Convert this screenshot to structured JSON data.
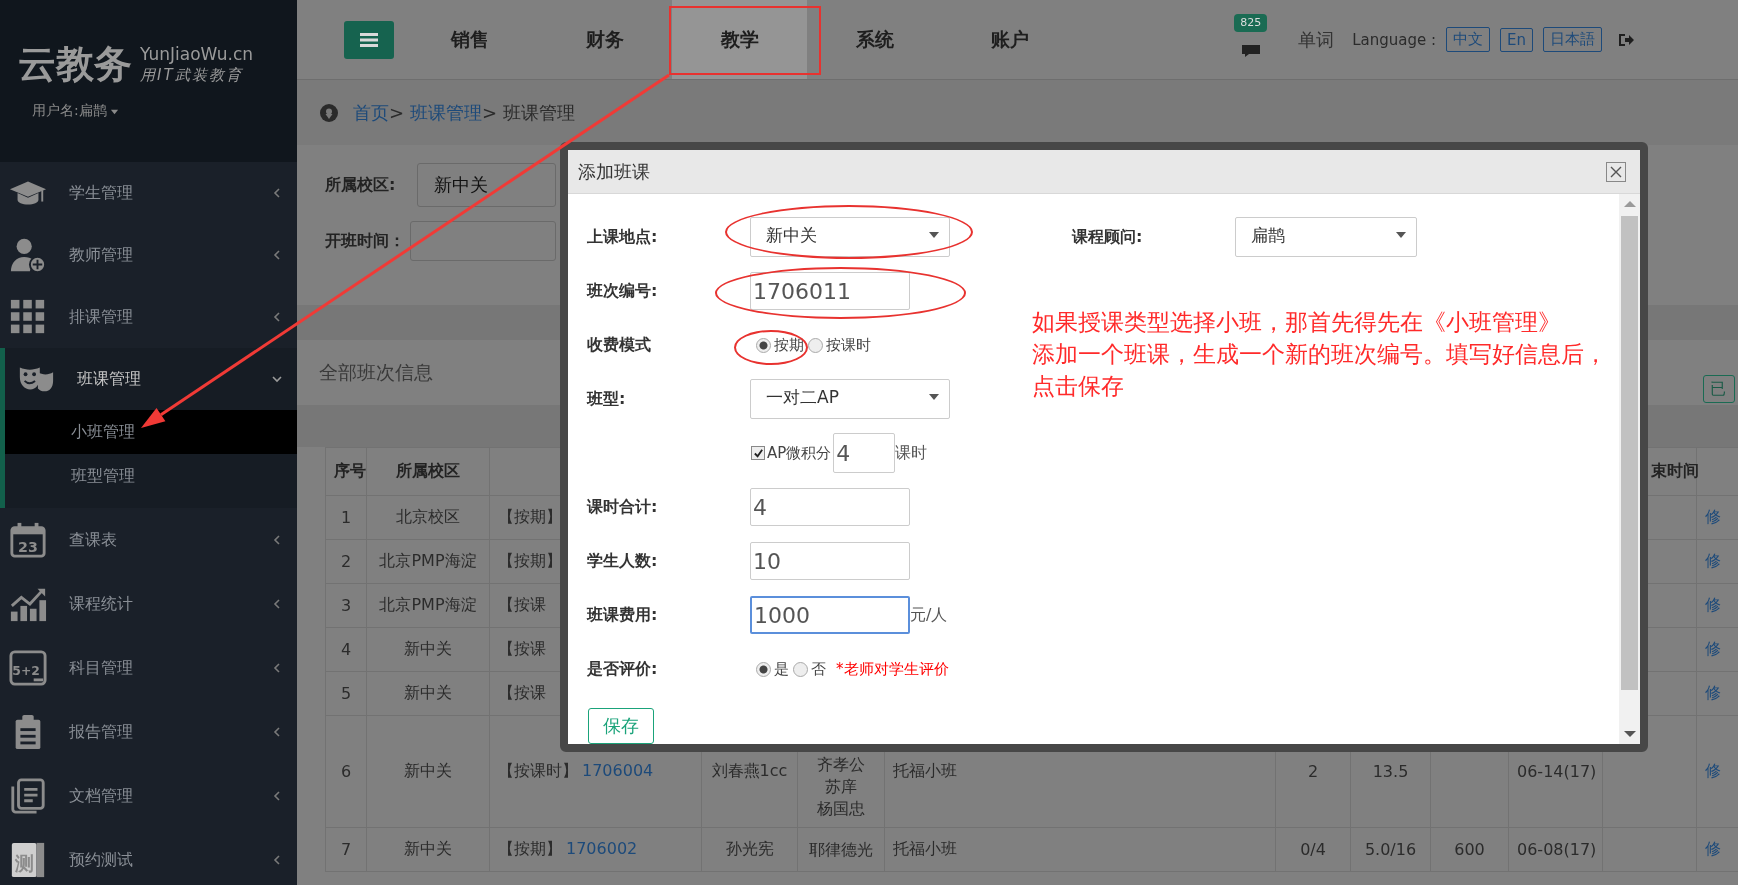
{
  "sidebar": {
    "logo": {
      "name": "云教务",
      "domain": "YunJiaoWu.cn",
      "slogan": "用IT武装教育"
    },
    "user": "用户名:扁鹊",
    "items": [
      {
        "label": "学生管理",
        "expanded": false
      },
      {
        "label": "教师管理",
        "expanded": false
      },
      {
        "label": "排课管理",
        "expanded": false
      },
      {
        "label": "班课管理",
        "expanded": true,
        "children": [
          {
            "label": "小班管理",
            "selected": true,
            "arrow_target": true
          },
          {
            "label": "班型管理",
            "selected": false,
            "arrow_target": false
          }
        ]
      },
      {
        "label": "查课表",
        "expanded": false,
        "icon_text": "23"
      },
      {
        "label": "课程统计",
        "expanded": false
      },
      {
        "label": "科目管理",
        "expanded": false,
        "icon_text": "5+2"
      },
      {
        "label": "报告管理",
        "expanded": false
      },
      {
        "label": "文档管理",
        "expanded": false
      },
      {
        "label": "预约测试",
        "expanded": false,
        "icon_text": "测"
      }
    ]
  },
  "topbar": {
    "tabs": [
      {
        "label": "销售",
        "selected": false,
        "circled": false
      },
      {
        "label": "财务",
        "selected": false,
        "circled": false
      },
      {
        "label": "教学",
        "selected": true,
        "circled": true
      },
      {
        "label": "系统",
        "selected": false,
        "circled": false
      },
      {
        "label": "账户",
        "selected": false,
        "circled": false
      }
    ],
    "message_count": "825",
    "words_link": "单词",
    "language_label": "Language :",
    "languages": [
      "中文",
      "En",
      "日本語"
    ]
  },
  "breadcrumb": {
    "items": [
      {
        "label": "首页",
        "link": true
      },
      {
        "label": "班课管理",
        "link": true
      },
      {
        "label": "班课管理",
        "link": false
      }
    ],
    "separator": ">"
  },
  "filters": [
    {
      "kind": "select",
      "label": "所属校区:",
      "value": "新中关"
    },
    {
      "kind": "text",
      "label": "开班时间："
    }
  ],
  "panel": {
    "title": "全部班次信息",
    "button": "已"
  },
  "table": {
    "columns": {
      "no": "序号",
      "campus": "所属校区",
      "end_time": "束时间"
    },
    "rows": [
      {
        "no": "1",
        "campus": "北京校区",
        "class_mode": "【按期】",
        "action": "修"
      },
      {
        "no": "2",
        "campus": "北京PMP海淀",
        "class_mode": "【按期】",
        "action": "修"
      },
      {
        "no": "3",
        "campus": "北京PMP海淀",
        "class_mode": "【按课",
        "action": "修"
      },
      {
        "no": "4",
        "campus": "新中关",
        "class_mode": "【按课",
        "action": "修"
      },
      {
        "no": "5",
        "campus": "新中关",
        "class_mode": "【按课",
        "action": "修"
      },
      {
        "no": "6",
        "campus": "新中关",
        "class_mode": "【按课时】",
        "class_no": "1706004",
        "teacher": "刘春燕1cc",
        "students": [
          "齐孝公",
          "苏庠",
          "杨国忠"
        ],
        "course": "托福小班",
        "column_7": "2",
        "column_8": "13.5",
        "column_10": "06-14(17)",
        "action": "修"
      },
      {
        "no": "7",
        "campus": "新中关",
        "class_mode": "【按期】",
        "class_no": "1706002",
        "teacher": "孙光宪",
        "students": [
          "耶律德光"
        ],
        "course": "托福小班",
        "column_7": "0/4",
        "column_8": "5.0/16",
        "column_9": "600",
        "column_10": "06-08(17)",
        "action": "修"
      }
    ]
  },
  "modal": {
    "title": "添加班课",
    "fields": [
      {
        "kind": "select",
        "label": "上课地点:",
        "value": "新中关",
        "circled": true
      },
      {
        "kind": "text",
        "label": "班次编号:",
        "value": "1706011",
        "circled": true
      },
      {
        "kind": "radio",
        "label": "收费模式",
        "options": [
          {
            "label": "按期",
            "selected": true,
            "circled": true
          },
          {
            "label": "按课时",
            "selected": false,
            "circled": false
          }
        ]
      },
      {
        "kind": "select",
        "label": "班型:",
        "value": "一对二AP",
        "circled": false
      },
      {
        "kind": "checkbox",
        "checked": true,
        "checkbox_label": "AP微积分",
        "value": "4",
        "unit": "课时"
      },
      {
        "kind": "text",
        "label": "课时合计:",
        "value": "4",
        "circled": false
      },
      {
        "kind": "text",
        "label": "学生人数:",
        "value": "10",
        "circled": false
      },
      {
        "kind": "text",
        "label": "班课费用:",
        "value": "1000",
        "unit": "元/人",
        "focused": true,
        "circled": false
      },
      {
        "kind": "radio",
        "label": "是否评价:",
        "options": [
          {
            "label": "是",
            "selected": true,
            "circled": false
          },
          {
            "label": "否",
            "selected": false,
            "circled": false
          }
        ],
        "note": "*老师对学生评价"
      }
    ],
    "advisor": {
      "label": "课程顾问:",
      "value": "扁鹊"
    },
    "annotation": [
      "如果授课类型选择小班，那首先得先在《小班管理》",
      "添加一个班课，生成一个新的班次编号。填写好信息后，",
      "点击保存"
    ],
    "save_button": "保存"
  }
}
